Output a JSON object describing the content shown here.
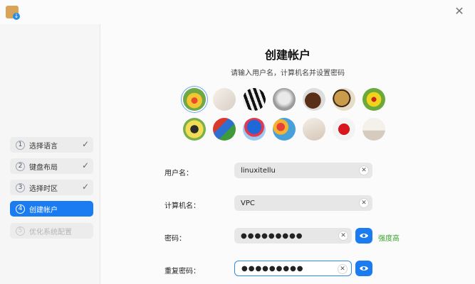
{
  "header": {
    "app_icon": "installer-package-icon",
    "close_icon": "close-icon"
  },
  "sidebar": {
    "steps": [
      {
        "num": "1",
        "label": "选择语言",
        "state": "done"
      },
      {
        "num": "2",
        "label": "键盘布局",
        "state": "done"
      },
      {
        "num": "3",
        "label": "选择时区",
        "state": "done"
      },
      {
        "num": "4",
        "label": "创建帐户",
        "state": "active"
      },
      {
        "num": "5",
        "label": "优化系统配置",
        "state": "disabled"
      }
    ],
    "check_glyph": "✓"
  },
  "main": {
    "title": "创建帐户",
    "subtitle": "请输入用户名，计算机名并设置密码",
    "avatars": [
      "flower-avatar",
      "clock-avatar",
      "piano-avatar",
      "cat-avatar",
      "horse-avatar",
      "leopard-avatar",
      "yellow-flower-avatar",
      "butterfly-avatar",
      "parrot-avatar",
      "balloon-avatar",
      "balloons-avatar",
      "shell-avatar",
      "heart-avatar",
      "room-avatar"
    ],
    "form": {
      "username_label": "用户名：",
      "username_value": "linuxitellu",
      "computer_label": "计算机名：",
      "computer_value": "VPC",
      "password_label": "密码：",
      "password_value": "●●●●●●●●●",
      "repeat_label": "重复密码：",
      "repeat_value": "●●●●●●●●●",
      "strength": "强度高",
      "clear_glyph": "✕"
    }
  },
  "colors": {
    "accent": "#1a7cf0",
    "strength": "#39a82d"
  }
}
